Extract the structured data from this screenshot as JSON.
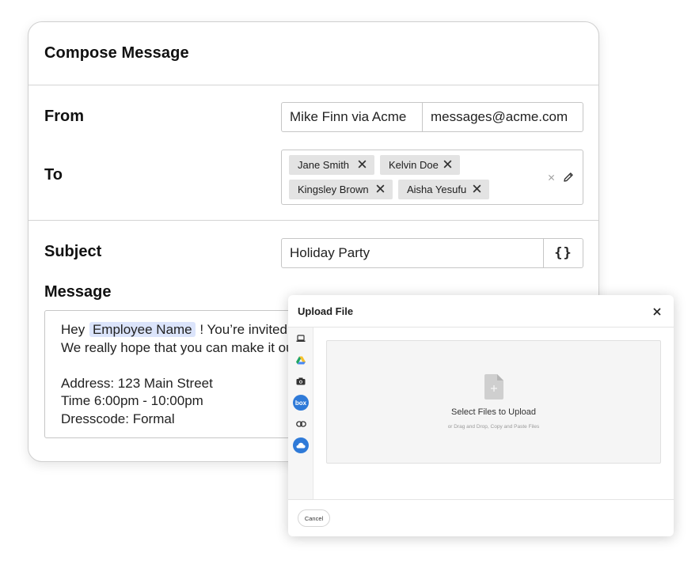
{
  "compose": {
    "title": "Compose Message",
    "from_label": "From",
    "from_name": "Mike Finn via Acme",
    "from_email": "messages@acme.com",
    "to_label": "To",
    "recipients": [
      "Jane Smith",
      "Kelvin Doe",
      "Kingsley Brown",
      "Aisha Yesufu"
    ],
    "to_clear_icon": "clear-icon",
    "to_edit_icon": "pencil-icon",
    "subject_label": "Subject",
    "subject_value": "Holiday Party",
    "variable_button": "{}",
    "message_label": "Message",
    "message": {
      "greeting": "Hey",
      "token": "Employee Name",
      "line1_rest": "!  You’re invited",
      "line2": "We really hope that you can make it ou",
      "address": "Address: 123 Main Street",
      "time": "Time 6:00pm - 10:00pm",
      "dresscode": "Dresscode: Formal"
    }
  },
  "upload": {
    "title": "Upload File",
    "close_icon": "close-icon",
    "sources": [
      {
        "name": "computer",
        "icon": "laptop-icon"
      },
      {
        "name": "google-drive",
        "icon": "google-drive-icon"
      },
      {
        "name": "camera",
        "icon": "camera-icon"
      },
      {
        "name": "box",
        "icon": "box-icon",
        "label": "box"
      },
      {
        "name": "link",
        "icon": "link-icon"
      },
      {
        "name": "onedrive",
        "icon": "onedrive-icon"
      }
    ],
    "drop_title": "Select Files to Upload",
    "drop_hint": "or Drag and Drop, Copy and Paste Files",
    "cancel_label": "Cancel"
  },
  "colors": {
    "token_bg": "#dbe4fb",
    "chip_bg": "#e3e3e3",
    "accent_blue": "#2f7ad8"
  }
}
